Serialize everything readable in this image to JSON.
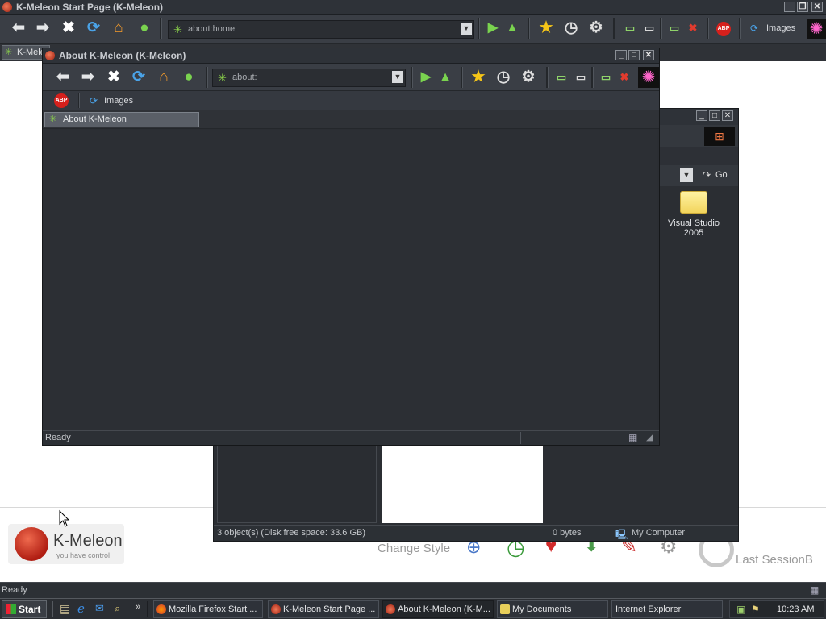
{
  "main_window": {
    "title": "K-Meleon Start Page (K-Meleon)",
    "url": "about:home",
    "images_label": "Images",
    "tab_label": "K-Mele",
    "status": "Ready",
    "abp": "ABP"
  },
  "start_page": {
    "logo_name": "K-Meleon",
    "logo_tagline": "you have control",
    "change_style": "Change Style",
    "last_session": "Last SessionB"
  },
  "explorer": {
    "go_label": "Go",
    "folder_name": "Visual Studio 2005",
    "status_objects": "3 object(s) (Disk free space: 33.6 GB)",
    "status_size": "0 bytes",
    "status_location": "My Computer"
  },
  "about_window": {
    "title": "About K-Meleon (K-Meleon)",
    "url": "about:",
    "images_label": "Images",
    "tab_label": "About K-Meleon",
    "status": "Ready",
    "abp": "ABP"
  },
  "taskbar": {
    "start_label": "Start",
    "tasks": [
      "Mozilla Firefox Start ...",
      "K-Meleon Start Page ...",
      "About K-Meleon (K-M...",
      "My Documents",
      "Internet Explorer"
    ],
    "clock": "10:23 AM"
  },
  "colors": {
    "chrome_dark": "#2b2e33",
    "toolbar": "#3a3e45",
    "accent_green": "#8bd24a",
    "abp_red": "#d6201c",
    "brand_red": "#c0261a"
  }
}
